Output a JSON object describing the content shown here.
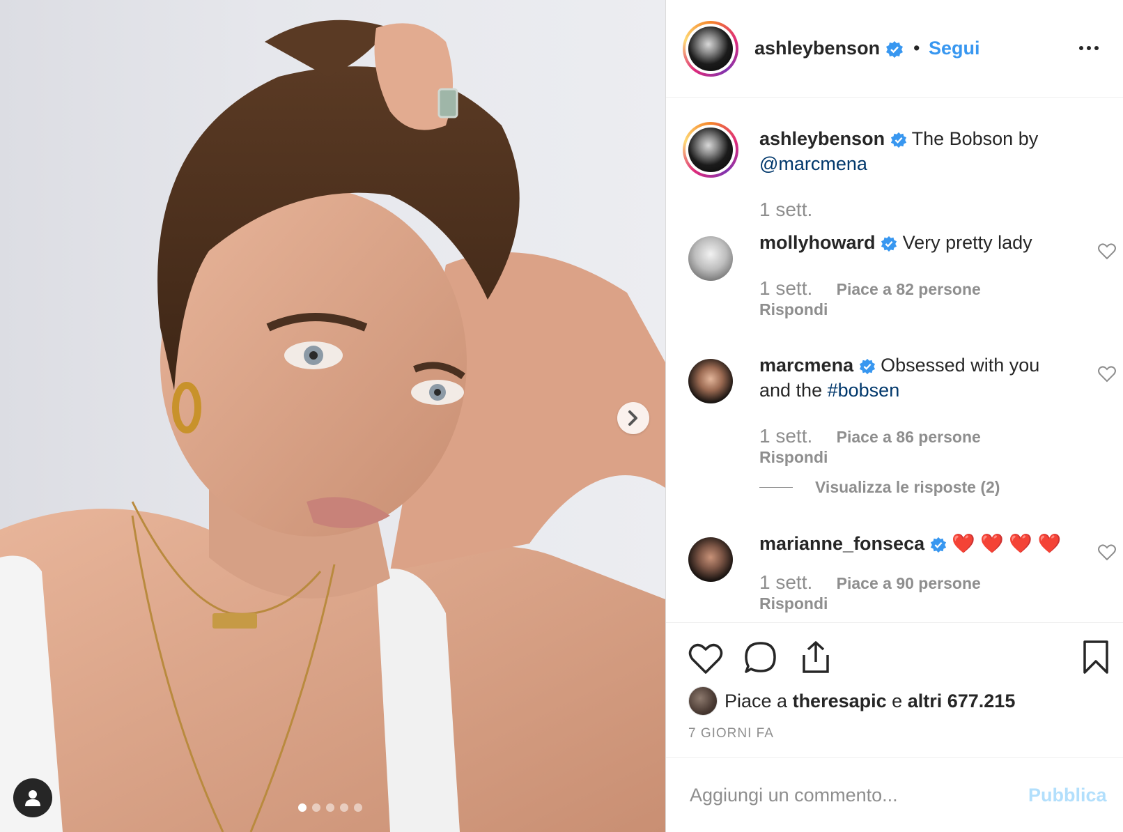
{
  "post": {
    "image_description_icons": {
      "next": "chevron-right-icon",
      "tags": "user-icon"
    },
    "carousel": {
      "total": 5,
      "active": 1
    }
  },
  "header": {
    "username": "ashleybenson",
    "separator": "•",
    "follow_label": "Segui",
    "more_icon": "ellipsis-icon"
  },
  "caption": {
    "username": "ashleybenson",
    "text": "The Bobson by",
    "mention": "@marcmena",
    "time": "1 sett."
  },
  "comments": [
    {
      "username": "mollyhoward",
      "text": "Very pretty lady",
      "time": "1 sett.",
      "likes": "Piace a 82 persone",
      "reply": "Rispondi"
    },
    {
      "username": "marcmena",
      "text": "Obsessed with you and the",
      "hashtag": "#bobsen",
      "time": "1 sett.",
      "likes": "Piace a 86 persone",
      "reply": "Rispondi",
      "view_replies": "Visualizza le risposte (2)"
    },
    {
      "username": "marianne_fonseca",
      "text": "❤️ ❤️ ❤️ ❤️",
      "time": "1 sett.",
      "likes": "Piace a 90 persone",
      "reply": "Rispondi"
    }
  ],
  "actions": {
    "icons": [
      "heart-icon",
      "comment-icon",
      "share-icon",
      "bookmark-icon"
    ]
  },
  "likes_summary": {
    "prefix": "Piace a",
    "user": "theresapic",
    "joiner": "e",
    "rest": "altri 677.215"
  },
  "date": "7 GIORNI FA",
  "add_comment": {
    "placeholder": "Aggiungi un commento...",
    "publish_label": "Pubblica"
  },
  "colors": {
    "link_blue": "#3897f0",
    "mention_blue": "#00376b",
    "verified_blue": "#3897f0",
    "muted": "#8e8e8e",
    "publish_disabled": "#b2dffc"
  }
}
